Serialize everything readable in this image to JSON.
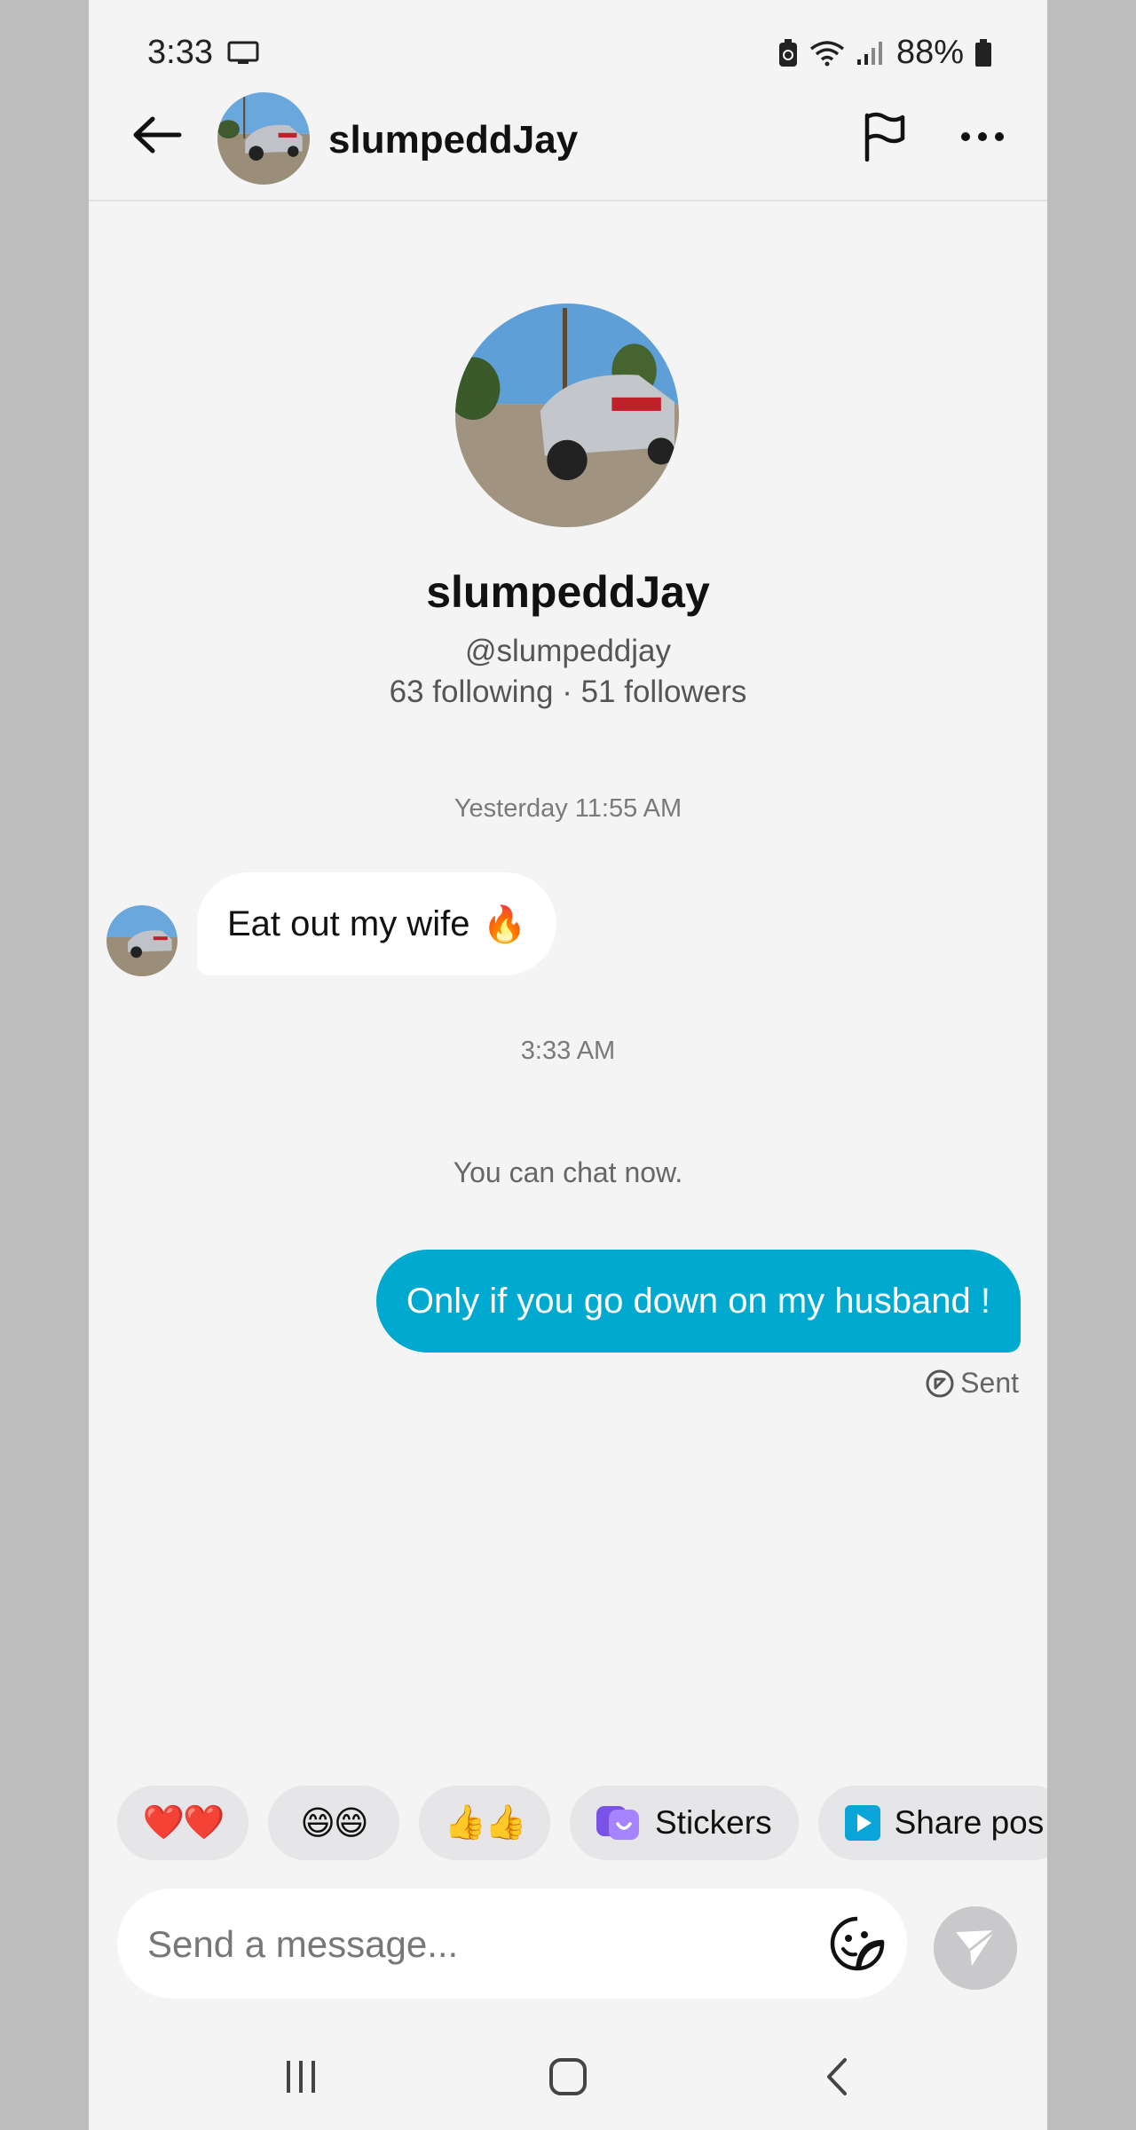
{
  "status_bar": {
    "time": "3:33",
    "battery": "88%"
  },
  "header": {
    "username": "slumpeddJay"
  },
  "profile": {
    "name": "slumpeddJay",
    "handle": "@slumpeddjay",
    "stats": "63 following · 51 followers"
  },
  "chat": {
    "timestamp_1": "Yesterday 11:55 AM",
    "incoming_message": "Eat out my wife",
    "incoming_emoji": "🔥",
    "timestamp_2": "3:33 AM",
    "system_note": "You can chat now.",
    "outgoing_message": "Only if you go down on my husband !",
    "sent_label": "Sent"
  },
  "quick_replies": {
    "hearts": "❤️❤️",
    "laughs": "😄😄",
    "thumbs": "👍👍",
    "stickers": "Stickers",
    "share_post": "Share pos"
  },
  "composer": {
    "placeholder": "Send a message..."
  },
  "colors": {
    "accent": "#00a9cf",
    "background": "#f4f4f5"
  }
}
